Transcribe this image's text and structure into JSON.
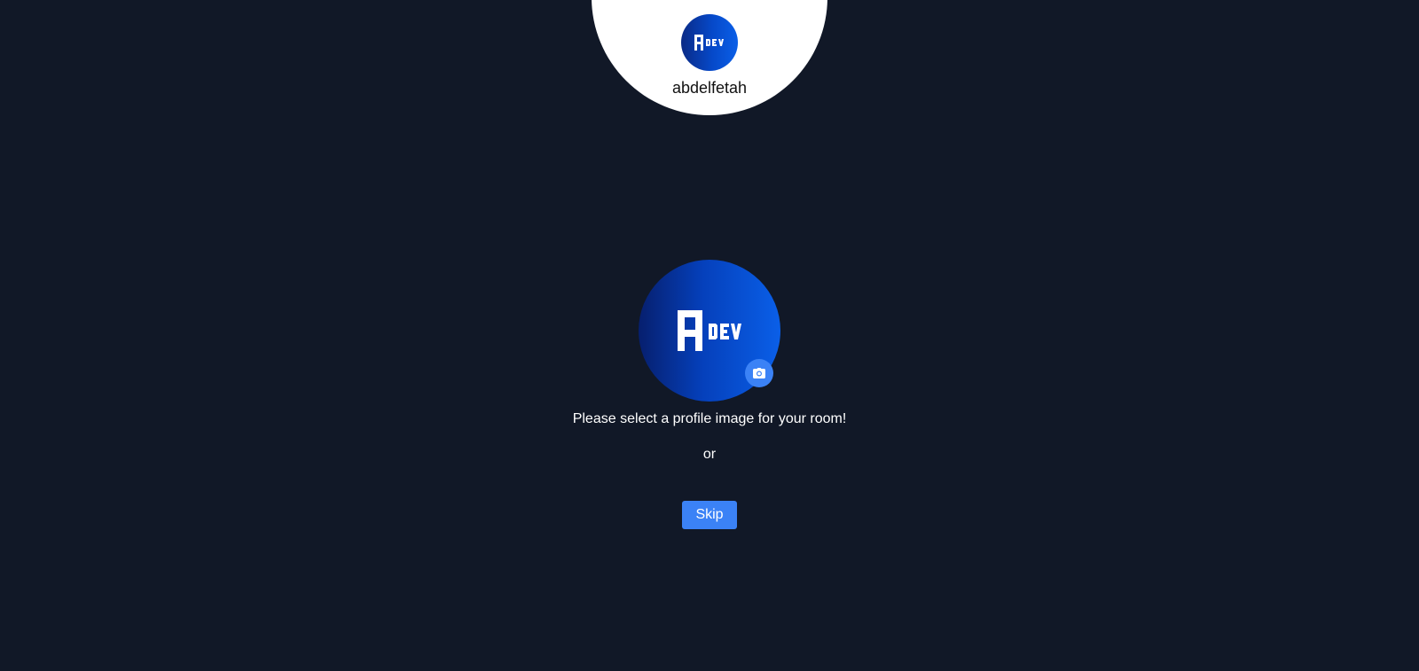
{
  "user": {
    "name": "abdelfetah",
    "avatar_icon": "adev-logo-icon"
  },
  "profile_picker": {
    "logo_icon": "adev-logo-icon",
    "camera_icon": "camera-icon"
  },
  "prompt": "Please select a profile image for your room!",
  "separator": "or",
  "skip_label": "Skip",
  "colors": {
    "background": "#111827",
    "accent": "#3b82f6",
    "logo_gradient_dark": "#061f6e",
    "logo_gradient_light": "#0a5fe8"
  }
}
